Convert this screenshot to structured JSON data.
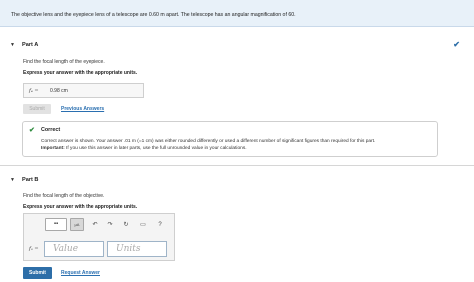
{
  "problem": {
    "statement": "The objective lens and the eyepiece lens of a telescope are 0.60  m apart. The telescope has an angular magnification of 60."
  },
  "part_a": {
    "title": "Part A",
    "check_icon": "checkmark-icon",
    "question": "Find the focal length of the eyepiece.",
    "instruction": "Express your answer with the appropriate units.",
    "answer_label": "fₑ =",
    "answer_value": "0.98 cm",
    "submit_label": "Submit",
    "previous_answers_label": "Previous Answers",
    "feedback": {
      "title": "Correct",
      "message": "Correct answer is shown. Your answer .01 m (=1 cm) was either rounded differently or used a different number of significant figures than required for this part.",
      "important_label": "Important:",
      "important_text": " If you use this answer in later parts, use the full unrounded value in your calculations."
    }
  },
  "part_b": {
    "title": "Part B",
    "question": "Find the focal length of the objective.",
    "instruction": "Express your answer with the appropriate units.",
    "answer_label": "fₒ =",
    "value_placeholder": "Value",
    "units_placeholder": "Units",
    "toolbar": {
      "template_label": "▪▪",
      "units_label": "μA",
      "undo": "↶",
      "redo": "↷",
      "reset": "↻",
      "keyboard": "▭",
      "help": "?"
    },
    "submit_label": "Submit",
    "request_answer_label": "Request Answer"
  },
  "colors": {
    "accent": "#2d6ea8",
    "correct": "#2e8b3e",
    "header_bg": "#e8f1f9"
  }
}
